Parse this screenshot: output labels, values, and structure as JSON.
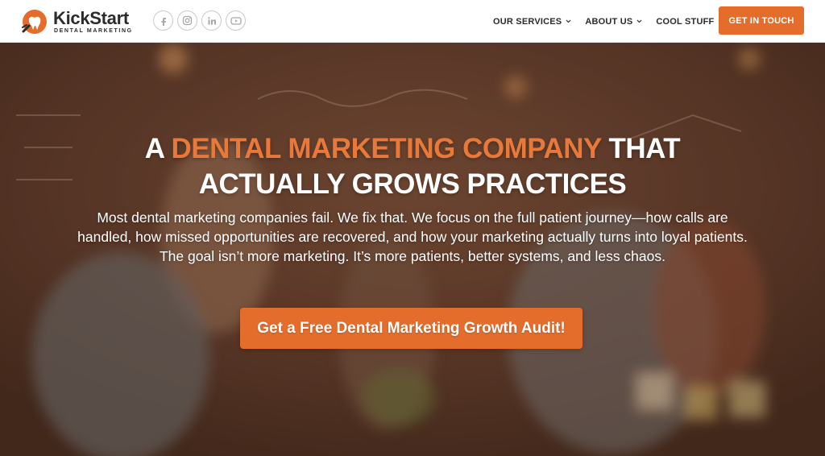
{
  "header": {
    "logo": {
      "name": "KickStart",
      "tagline": "DENTAL MARKETING",
      "icon": "tooth-rocket-icon"
    },
    "socials": [
      {
        "name": "facebook",
        "icon": "facebook-icon"
      },
      {
        "name": "instagram",
        "icon": "instagram-icon"
      },
      {
        "name": "linkedin",
        "icon": "linkedin-icon"
      },
      {
        "name": "youtube",
        "icon": "youtube-icon"
      }
    ],
    "nav": [
      {
        "label": "OUR SERVICES",
        "icon": "chevron-down-icon"
      },
      {
        "label": "ABOUT US",
        "icon": "chevron-down-icon"
      },
      {
        "label": "COOL STUFF",
        "icon": "chevron-down-icon"
      }
    ],
    "cta_label": "GET IN TOUCH"
  },
  "hero": {
    "headline_pre": "A ",
    "headline_accent": "DENTAL MARKETING COMPANY",
    "headline_post": " THAT ACTUALLY GROWS PRACTICES",
    "subtext": "Most dental marketing companies fail. We fix that. We focus on the full patient journey—how calls are handled, how missed opportunities are recovered, and how your marketing actually turns into loyal patients. The goal isn’t more marketing. It’s more patients, better systems, and less chaos.",
    "cta_label": "Get a Free Dental Marketing Growth Audit!"
  },
  "colors": {
    "brand_orange": "#e56d2b",
    "accent_text": "#e8793a",
    "dark_text": "#2b2b2b",
    "header_bg": "#ffffff"
  }
}
